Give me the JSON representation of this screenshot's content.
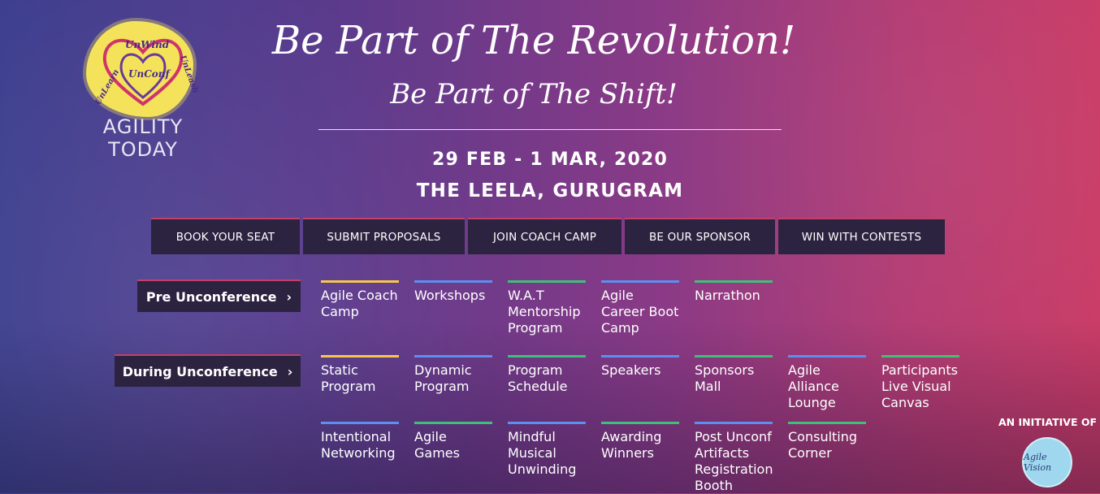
{
  "logo": {
    "word1": "UnWind",
    "word2": "UnConf",
    "word3": "UnLeash",
    "word4": "UnLearn",
    "brand": "AGILITY TODAY"
  },
  "headline": {
    "line1": "Be Part of The Revolution!",
    "line2": "Be Part of The Shift!"
  },
  "event": {
    "date": "29 FEB - 1 MAR, 2020",
    "venue": "THE LEELA, GURUGRAM"
  },
  "nav": [
    {
      "label": "BOOK YOUR SEAT"
    },
    {
      "label": "SUBMIT PROPOSALS"
    },
    {
      "label": "JOIN COACH CAMP"
    },
    {
      "label": "BE OUR SPONSOR"
    },
    {
      "label": "WIN WITH CONTESTS"
    }
  ],
  "sections": {
    "pre": {
      "label": "Pre Unconference",
      "chevron": "›",
      "items": [
        {
          "label": "Agile Coach Camp",
          "color": "#f5c84b"
        },
        {
          "label": "Workshops",
          "color": "#5b8ff0"
        },
        {
          "label": "W.A.T Mentorship Program",
          "color": "#3fc07a"
        },
        {
          "label": "Agile Career Boot Camp",
          "color": "#5b8ff0"
        },
        {
          "label": "Narrathon",
          "color": "#3fc07a"
        }
      ]
    },
    "during": {
      "label": "During Unconference",
      "chevron": "›",
      "items": [
        {
          "label": "Static Program",
          "color": "#f5c84b"
        },
        {
          "label": "Dynamic Program",
          "color": "#5b8ff0"
        },
        {
          "label": "Program Schedule",
          "color": "#3fc07a"
        },
        {
          "label": "Speakers",
          "color": "#5b8ff0"
        },
        {
          "label": "Sponsors Mall",
          "color": "#3fc07a"
        },
        {
          "label": "Agile Alliance Lounge",
          "color": "#5b8ff0"
        },
        {
          "label": "Participants Live Visual Canvas",
          "color": "#3fc07a"
        },
        {
          "label": "Intentional Networking",
          "color": "#5b8ff0"
        },
        {
          "label": "Agile Games",
          "color": "#3fc07a"
        },
        {
          "label": "Mindful Musical Unwinding",
          "color": "#5b8ff0"
        },
        {
          "label": "Awarding Winners",
          "color": "#3fc07a"
        },
        {
          "label": "Post Unconf Artifacts Registration Booth",
          "color": "#5b8ff0"
        },
        {
          "label": "Consulting Corner",
          "color": "#3fc07a"
        }
      ]
    }
  },
  "footer": {
    "initiative": "AN INITIATIVE OF",
    "badge_text": "Agile Vision"
  }
}
